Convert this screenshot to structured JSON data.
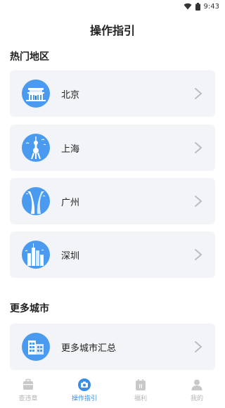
{
  "status_bar": {
    "time": "9:43"
  },
  "header": {
    "title": "操作指引"
  },
  "sections": {
    "hot": {
      "title": "热门地区",
      "items": [
        {
          "label": "北京",
          "icon": "beijing-landmark-icon"
        },
        {
          "label": "上海",
          "icon": "shanghai-tower-icon"
        },
        {
          "label": "广州",
          "icon": "guangzhou-tower-icon"
        },
        {
          "label": "深圳",
          "icon": "shenzhen-skyline-icon"
        }
      ]
    },
    "more": {
      "title": "更多城市",
      "items": [
        {
          "label": "更多城市汇总",
          "icon": "buildings-icon"
        }
      ]
    }
  },
  "tabbar": {
    "tabs": [
      {
        "label": "查违章",
        "icon": "briefcase-icon",
        "active": false
      },
      {
        "label": "操作指引",
        "icon": "camera-icon",
        "active": true
      },
      {
        "label": "福利",
        "icon": "calendar-icon",
        "active": false
      },
      {
        "label": "我的",
        "icon": "person-icon",
        "active": false
      }
    ]
  },
  "colors": {
    "accent": "#3a8ee6",
    "card_bg": "#f2f4f8",
    "icon_blue": "#4a9bef",
    "tab_inactive": "#b5b5b5"
  }
}
